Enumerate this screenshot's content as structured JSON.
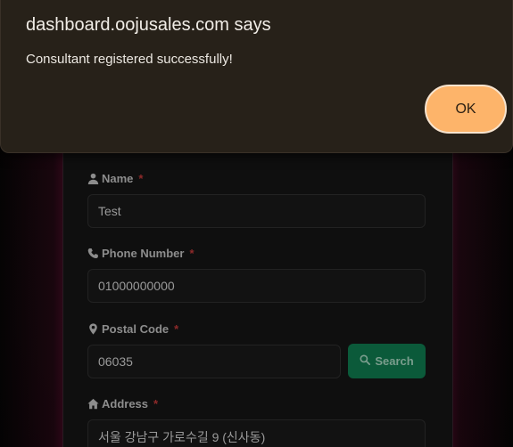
{
  "dialog": {
    "title": "dashboard.oojusales.com says",
    "message": "Consultant registered successfully!",
    "ok_label": "OK"
  },
  "form": {
    "name": {
      "icon": "user-icon",
      "label": "Name",
      "required_mark": "*",
      "value": "Test"
    },
    "phone": {
      "icon": "phone-icon",
      "label": "Phone Number",
      "required_mark": "*",
      "value": "01000000000"
    },
    "postal": {
      "icon": "map-pin-icon",
      "label": "Postal Code",
      "required_mark": "*",
      "value": "06035",
      "search_label": "Search",
      "search_icon": "search-icon"
    },
    "address": {
      "icon": "home-icon",
      "label": "Address",
      "required_mark": "*",
      "value": "서울 강남구 가로수길 9 (신사동)"
    }
  },
  "colors": {
    "dialog_bg": "#272119",
    "ok_button": "#fdb46a",
    "search_button": "#0b5a3a",
    "required_mark": "#8e2a2a"
  }
}
